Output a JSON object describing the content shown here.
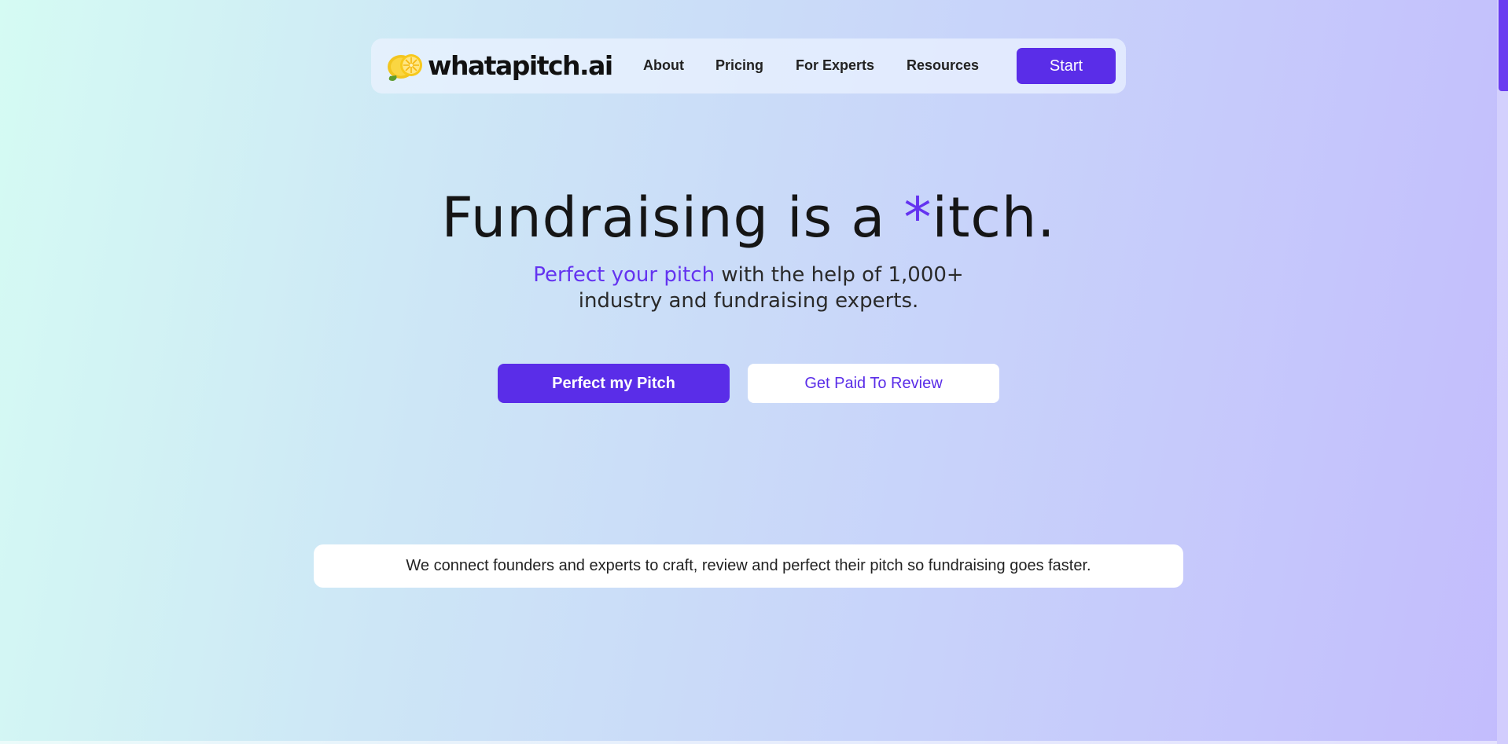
{
  "brand": {
    "name": "whatapitch.ai",
    "logo_icon": "lemon-icon"
  },
  "nav": {
    "links": [
      "About",
      "Pricing",
      "For Experts",
      "Resources"
    ],
    "start_label": "Start"
  },
  "hero": {
    "title_before": "Fundraising is a ",
    "title_accent": "*",
    "title_after": "itch.",
    "subtitle_accent": "Perfect your pitch",
    "subtitle_line1_rest": " with the help of 1,000+",
    "subtitle_line2": "industry and fundraising experts."
  },
  "cta": {
    "primary_label": "Perfect my Pitch",
    "secondary_label": "Get Paid To Review"
  },
  "mission": {
    "text": "We connect founders and experts to craft, review and perfect their pitch so fundraising goes faster."
  },
  "colors": {
    "accent": "#5a2de8",
    "accent_text": "#6433f0",
    "gradient_start": "#d5fbf3",
    "gradient_end": "#c3bcfd"
  }
}
